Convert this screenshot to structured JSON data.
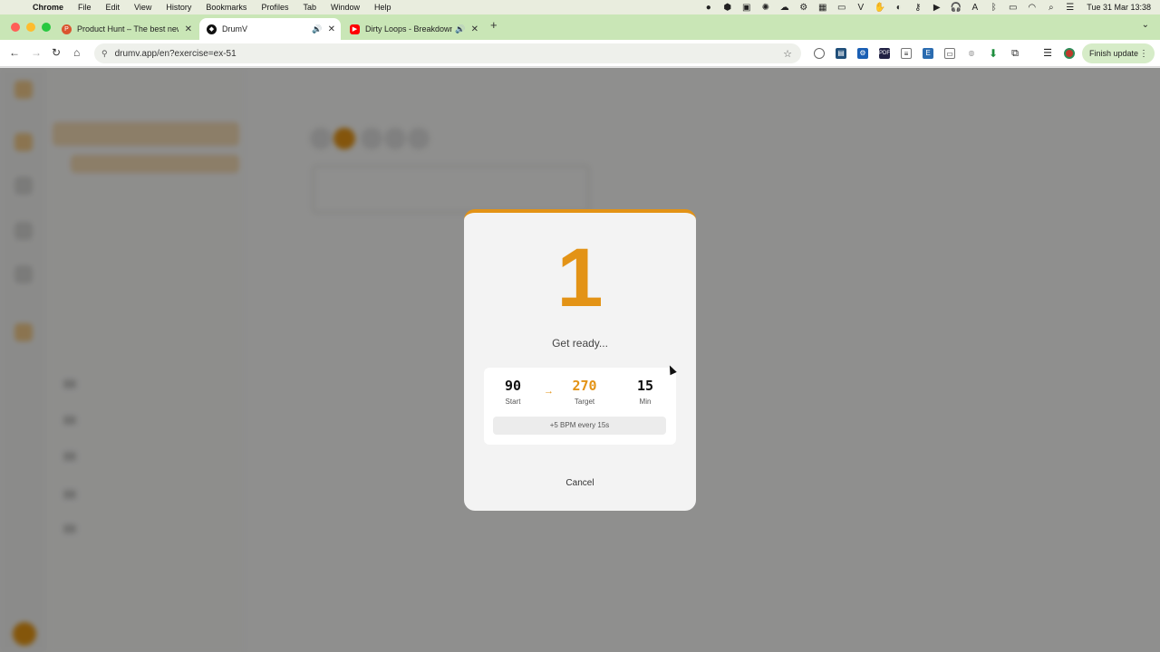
{
  "menubar": {
    "app_name": "Chrome",
    "items": [
      "File",
      "Edit",
      "View",
      "History",
      "Bookmarks",
      "Profiles",
      "Tab",
      "Window",
      "Help"
    ],
    "clock": "Tue 31 Mar  13:38"
  },
  "tabs": [
    {
      "title": "Product Hunt – The best new",
      "favicon": "product-hunt-icon",
      "color": "#da552f"
    },
    {
      "title": "DrumV",
      "favicon": "drumv-icon",
      "color": "#111111"
    },
    {
      "title": "Dirty Loops - Breakdown",
      "favicon": "youtube-icon",
      "color": "#ff0000"
    }
  ],
  "toolbar": {
    "url": "drumv.app/en?exercise=ex-51",
    "finish_update_label": "Finish update"
  },
  "background": {
    "accent_color": "#e39316"
  },
  "modal": {
    "countdown": "1",
    "status_text": "Get ready...",
    "start_value": "90",
    "start_label": "Start",
    "target_value": "270",
    "target_label": "Target",
    "min_value": "15",
    "min_label": "Min",
    "rate_text": "+5 BPM every 15s",
    "cancel_label": "Cancel"
  }
}
